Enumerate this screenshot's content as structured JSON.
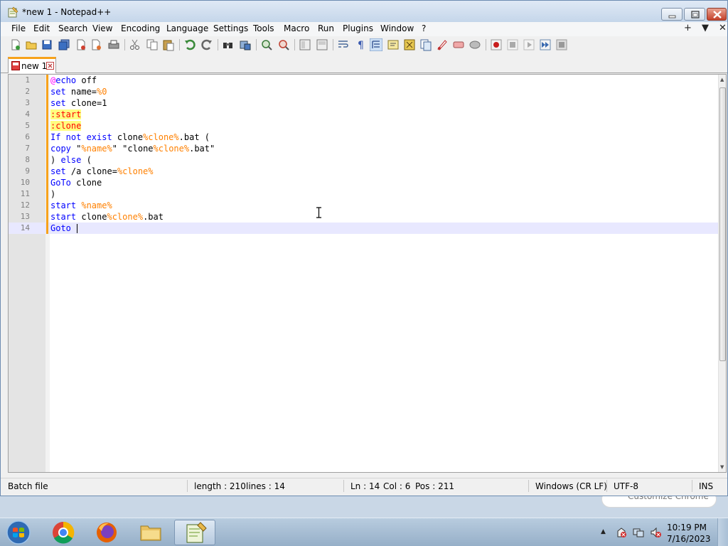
{
  "window": {
    "title": "*new 1 - Notepad++"
  },
  "menu": {
    "items": [
      "File",
      "Edit",
      "Search",
      "View",
      "Encoding",
      "Language",
      "Settings",
      "Tools",
      "Macro",
      "Run",
      "Plugins",
      "Window",
      "?"
    ],
    "right_controls": [
      "+",
      "▼",
      "✕"
    ]
  },
  "toolbar": {
    "icons": [
      "new-file-icon",
      "open-file-icon",
      "save-icon",
      "save-all-icon",
      "close-icon",
      "close-all-icon",
      "print-icon",
      "cut-icon",
      "copy-icon",
      "paste-icon",
      "undo-icon",
      "redo-icon",
      "find-icon",
      "replace-icon",
      "zoom-in-icon",
      "zoom-out-icon",
      "sync-vertical-icon",
      "sync-horizontal-icon",
      "word-wrap-icon",
      "show-all-chars-icon",
      "indent-guide-icon",
      "language-icon",
      "document-map-icon",
      "function-list-icon",
      "folder-workspace-icon",
      "monitoring-icon",
      "record-macro-icon",
      "stop-macro-icon",
      "play-macro-icon",
      "run-macro-multiple-icon",
      "save-macro-icon"
    ]
  },
  "tabs": [
    {
      "label": "new 1",
      "active": true,
      "modified": true
    }
  ],
  "editor": {
    "lines": [
      {
        "num": "1",
        "tokens": [
          {
            "t": "@",
            "c": "at"
          },
          {
            "t": "echo",
            "c": "kw"
          },
          {
            "t": " off",
            "c": "plain"
          }
        ]
      },
      {
        "num": "2",
        "tokens": [
          {
            "t": "set",
            "c": "kw"
          },
          {
            "t": " name=",
            "c": "plain"
          },
          {
            "t": "%0",
            "c": "var"
          }
        ]
      },
      {
        "num": "3",
        "tokens": [
          {
            "t": "set",
            "c": "kw"
          },
          {
            "t": " clone=1",
            "c": "plain"
          }
        ]
      },
      {
        "num": "4",
        "tokens": [
          {
            "t": ":start",
            "c": "label"
          }
        ]
      },
      {
        "num": "5",
        "tokens": [
          {
            "t": ":clone",
            "c": "label"
          }
        ]
      },
      {
        "num": "6",
        "tokens": [
          {
            "t": "If not exist",
            "c": "kw"
          },
          {
            "t": " clone",
            "c": "plain"
          },
          {
            "t": "%clone%",
            "c": "var"
          },
          {
            "t": ".bat (",
            "c": "plain"
          }
        ]
      },
      {
        "num": "7",
        "tokens": [
          {
            "t": "copy",
            "c": "kw"
          },
          {
            "t": " \"",
            "c": "plain"
          },
          {
            "t": "%name%",
            "c": "var"
          },
          {
            "t": "\" \"clone",
            "c": "plain"
          },
          {
            "t": "%clone%",
            "c": "var"
          },
          {
            "t": ".bat\"",
            "c": "plain"
          }
        ]
      },
      {
        "num": "8",
        "tokens": [
          {
            "t": ") ",
            "c": "plain"
          },
          {
            "t": "else",
            "c": "kw"
          },
          {
            "t": " (",
            "c": "plain"
          }
        ]
      },
      {
        "num": "9",
        "tokens": [
          {
            "t": "set",
            "c": "kw"
          },
          {
            "t": " /a clone=",
            "c": "plain"
          },
          {
            "t": "%clone%",
            "c": "var"
          }
        ]
      },
      {
        "num": "10",
        "tokens": [
          {
            "t": "GoTo",
            "c": "kw"
          },
          {
            "t": " clone",
            "c": "plain"
          }
        ]
      },
      {
        "num": "11",
        "tokens": [
          {
            "t": ")",
            "c": "plain"
          }
        ]
      },
      {
        "num": "12",
        "tokens": [
          {
            "t": "start",
            "c": "kw"
          },
          {
            "t": " ",
            "c": "plain"
          },
          {
            "t": "%name%",
            "c": "var"
          }
        ]
      },
      {
        "num": "13",
        "tokens": [
          {
            "t": "start",
            "c": "kw"
          },
          {
            "t": " clone",
            "c": "plain"
          },
          {
            "t": "%clone%",
            "c": "var"
          },
          {
            "t": ".bat",
            "c": "plain"
          }
        ]
      },
      {
        "num": "14",
        "tokens": [
          {
            "t": "Goto",
            "c": "kw"
          },
          {
            "t": " ",
            "c": "plain"
          }
        ],
        "current": true
      }
    ]
  },
  "statusbar": {
    "file_type": "Batch file",
    "length": "length : 210",
    "lines": "lines : 14",
    "ln": "Ln : 14",
    "col": "Col : 6",
    "pos": "Pos : 211",
    "eol": "Windows (CR LF)",
    "encoding": "UTF-8",
    "mode": "INS"
  },
  "taskbar": {
    "apps": [
      "chrome-icon",
      "firefox-icon",
      "file-explorer-icon",
      "notepadpp-icon"
    ],
    "clock_time": "10:19 PM",
    "clock_date": "7/16/2023"
  },
  "background": {
    "chrome_peek": "Customize Chrome"
  },
  "colors": {
    "accent_tab": "#f7a21b",
    "keyword": "#0000ff",
    "variable": "#ff8000",
    "label": "#ff0000",
    "label_bg": "#ffff80",
    "current_line": "#e8e8ff"
  }
}
